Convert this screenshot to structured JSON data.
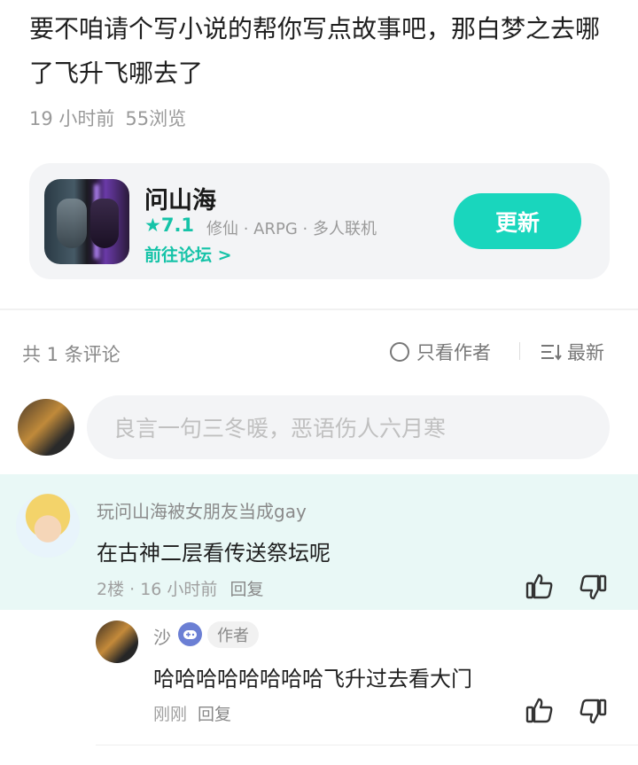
{
  "post": {
    "text": "要不咱请个写小说的帮你写点故事吧，那白梦之去哪了飞升飞哪去了",
    "time": "19 小时前",
    "views": "55浏览"
  },
  "game_card": {
    "title": "问山海",
    "rating": "★7.1",
    "tags": "修仙 · ARPG · 多人联机",
    "forum_link": "前往论坛 >",
    "update_label": "更新",
    "accent_color": "#19d6bd"
  },
  "comments_header": {
    "count": "共 1 条评论",
    "only_author": "只看作者",
    "sort": "最新"
  },
  "input": {
    "placeholder": "良言一句三冬暖，恶语伤人六月寒"
  },
  "comment": {
    "username": "玩问山海被女朋友当成gay",
    "body": "在古神二层看传送祭坛呢",
    "floor_time": "2楼 · 16 小时前",
    "reply_label": "回复"
  },
  "reply": {
    "username": "沙",
    "badge": "作者",
    "body": "哈哈哈哈哈哈哈哈飞升过去看大门",
    "time": "刚刚",
    "reply_label": "回复"
  }
}
